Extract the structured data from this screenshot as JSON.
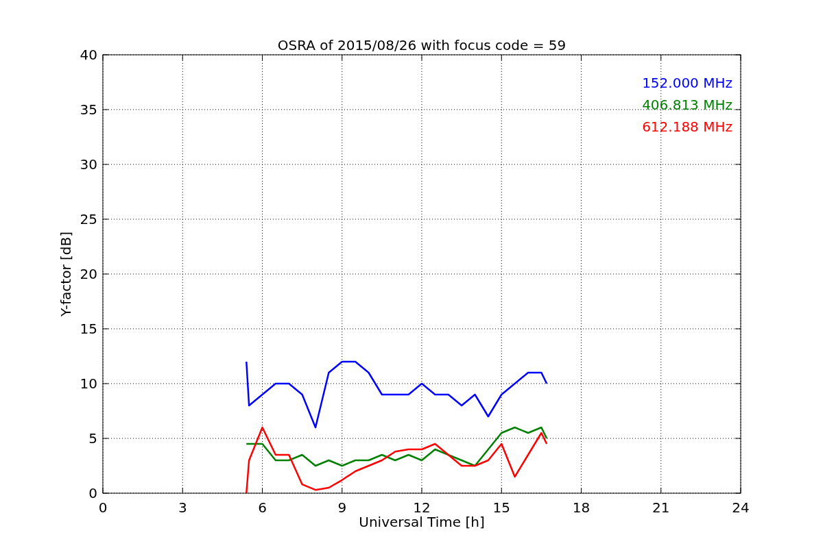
{
  "chart_data": {
    "type": "line",
    "title": "OSRA of 2015/08/26 with focus code = 59",
    "xlabel": "Universal Time [h]",
    "ylabel": "Y-factor [dB]",
    "x": [
      5.4,
      5.5,
      6.0,
      6.5,
      7.0,
      7.5,
      8.0,
      8.5,
      9.0,
      9.5,
      10.0,
      10.5,
      11.0,
      11.5,
      12.0,
      12.5,
      13.0,
      13.5,
      14.0,
      14.5,
      15.0,
      15.5,
      16.0,
      16.5,
      16.7
    ],
    "series": [
      {
        "name": "152.000 MHz",
        "color": "#0000ff",
        "values": [
          12,
          8,
          9,
          10,
          10,
          9,
          6,
          11,
          12,
          12,
          11,
          9,
          9,
          9,
          10,
          9,
          9,
          8,
          9,
          7,
          9,
          10,
          11,
          11,
          10
        ]
      },
      {
        "name": "406.813 MHz",
        "color": "#008000",
        "values": [
          4.5,
          4.5,
          4.5,
          3,
          3,
          3.5,
          2.5,
          3,
          2.5,
          3,
          3,
          3.5,
          3,
          3.5,
          3,
          4,
          3.5,
          3,
          2.5,
          4,
          5.5,
          6,
          5.5,
          6,
          5
        ]
      },
      {
        "name": "612.188 MHz",
        "color": "#ff0000",
        "values": [
          0,
          3,
          6,
          3.5,
          3.5,
          0.8,
          0.3,
          0.5,
          1.2,
          2,
          2.5,
          3,
          3.8,
          4,
          4,
          4.5,
          3.5,
          2.5,
          2.5,
          3,
          4.5,
          1.5,
          3.5,
          5.5,
          4.5
        ]
      }
    ],
    "grid": true,
    "xlim": [
      0,
      24
    ],
    "ylim": [
      0,
      40
    ],
    "xticks": [
      0,
      3,
      6,
      9,
      12,
      15,
      18,
      21,
      24
    ],
    "yticks": [
      0,
      5,
      10,
      15,
      20,
      25,
      30,
      35,
      40
    ]
  }
}
